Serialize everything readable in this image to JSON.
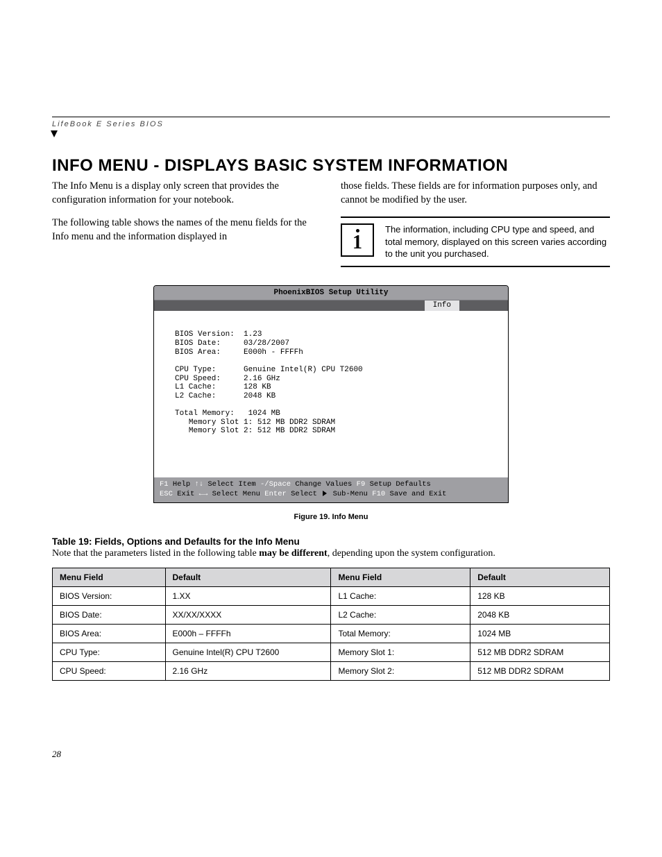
{
  "running_head": "LifeBook E Series BIOS",
  "title": "INFO MENU - DISPLAYS BASIC SYSTEM INFORMATION",
  "para1": "The Info Menu is a display only screen that provides the configuration information for your notebook.",
  "para2": "The following table shows the names of the menu fields for the Info menu and the information displayed in",
  "para3": "those fields. These fields are for information purposes only, and cannot be modified by the user.",
  "callout": "The information, including CPU type and speed, and total memory, displayed on this screen varies according to the unit you purchased.",
  "bios": {
    "title": "PhoenixBIOS Setup Utility",
    "tab": "Info",
    "fields": {
      "bios_version_label": "BIOS Version:",
      "bios_version": "1.23",
      "bios_date_label": "BIOS Date:",
      "bios_date": "03/28/2007",
      "bios_area_label": "BIOS Area:",
      "bios_area": "E000h - FFFFh",
      "cpu_type_label": "CPU Type:",
      "cpu_type": "Genuine Intel(R) CPU T2600",
      "cpu_speed_label": "CPU Speed:",
      "cpu_speed": "2.16 GHz",
      "l1_label": "L1 Cache:",
      "l1": "128 KB",
      "l2_label": "L2 Cache:",
      "l2": "2048 KB",
      "total_mem_label": "Total Memory:",
      "total_mem": "1024 MB",
      "slot1_label": "Memory Slot 1:",
      "slot1": "512 MB DDR2 SDRAM",
      "slot2_label": "Memory Slot 2:",
      "slot2": "512 MB DDR2 SDRAM"
    },
    "footer": {
      "f1": "F1",
      "help": "Help",
      "updn": "↑↓",
      "sel_item": "Select Item",
      "minsp": "-/Space",
      "chg_vals": "Change Values",
      "f9": "F9",
      "setup_def": "Setup Defaults",
      "esc": "ESC",
      "exit": "Exit",
      "lr": "←→",
      "sel_menu": "Select Menu",
      "enter": "Enter",
      "sel_sub": "Select",
      "sub_menu": "Sub-Menu",
      "f10": "F10",
      "save_exit": "Save and Exit"
    }
  },
  "fig_caption": "Figure 19.  Info Menu",
  "table_title": "Table 19: Fields, Options and Defaults for the Info Menu",
  "table_note_a": "Note that the parameters listed in the following table ",
  "table_note_b": "may be different",
  "table_note_c": ", depending upon the system configuration.",
  "headers": {
    "menu_field": "Menu Field",
    "default": "Default"
  },
  "rows_left": [
    {
      "field": "BIOS Version:",
      "def": "1.XX"
    },
    {
      "field": "BIOS Date:",
      "def": "XX/XX/XXXX"
    },
    {
      "field": "BIOS Area:",
      "def": "E000h – FFFFh"
    },
    {
      "field": "CPU Type:",
      "def": "Genuine Intel(R) CPU T2600"
    },
    {
      "field": "CPU Speed:",
      "def": "2.16 GHz"
    }
  ],
  "rows_right": [
    {
      "field": "L1 Cache:",
      "def": "128 KB"
    },
    {
      "field": "L2 Cache:",
      "def": "2048 KB"
    },
    {
      "field": "Total Memory:",
      "def": "1024 MB"
    },
    {
      "field": "Memory Slot 1:",
      "def": "512 MB DDR2 SDRAM"
    },
    {
      "field": "Memory Slot 2:",
      "def": "512 MB DDR2 SDRAM"
    }
  ],
  "page_number": "28"
}
